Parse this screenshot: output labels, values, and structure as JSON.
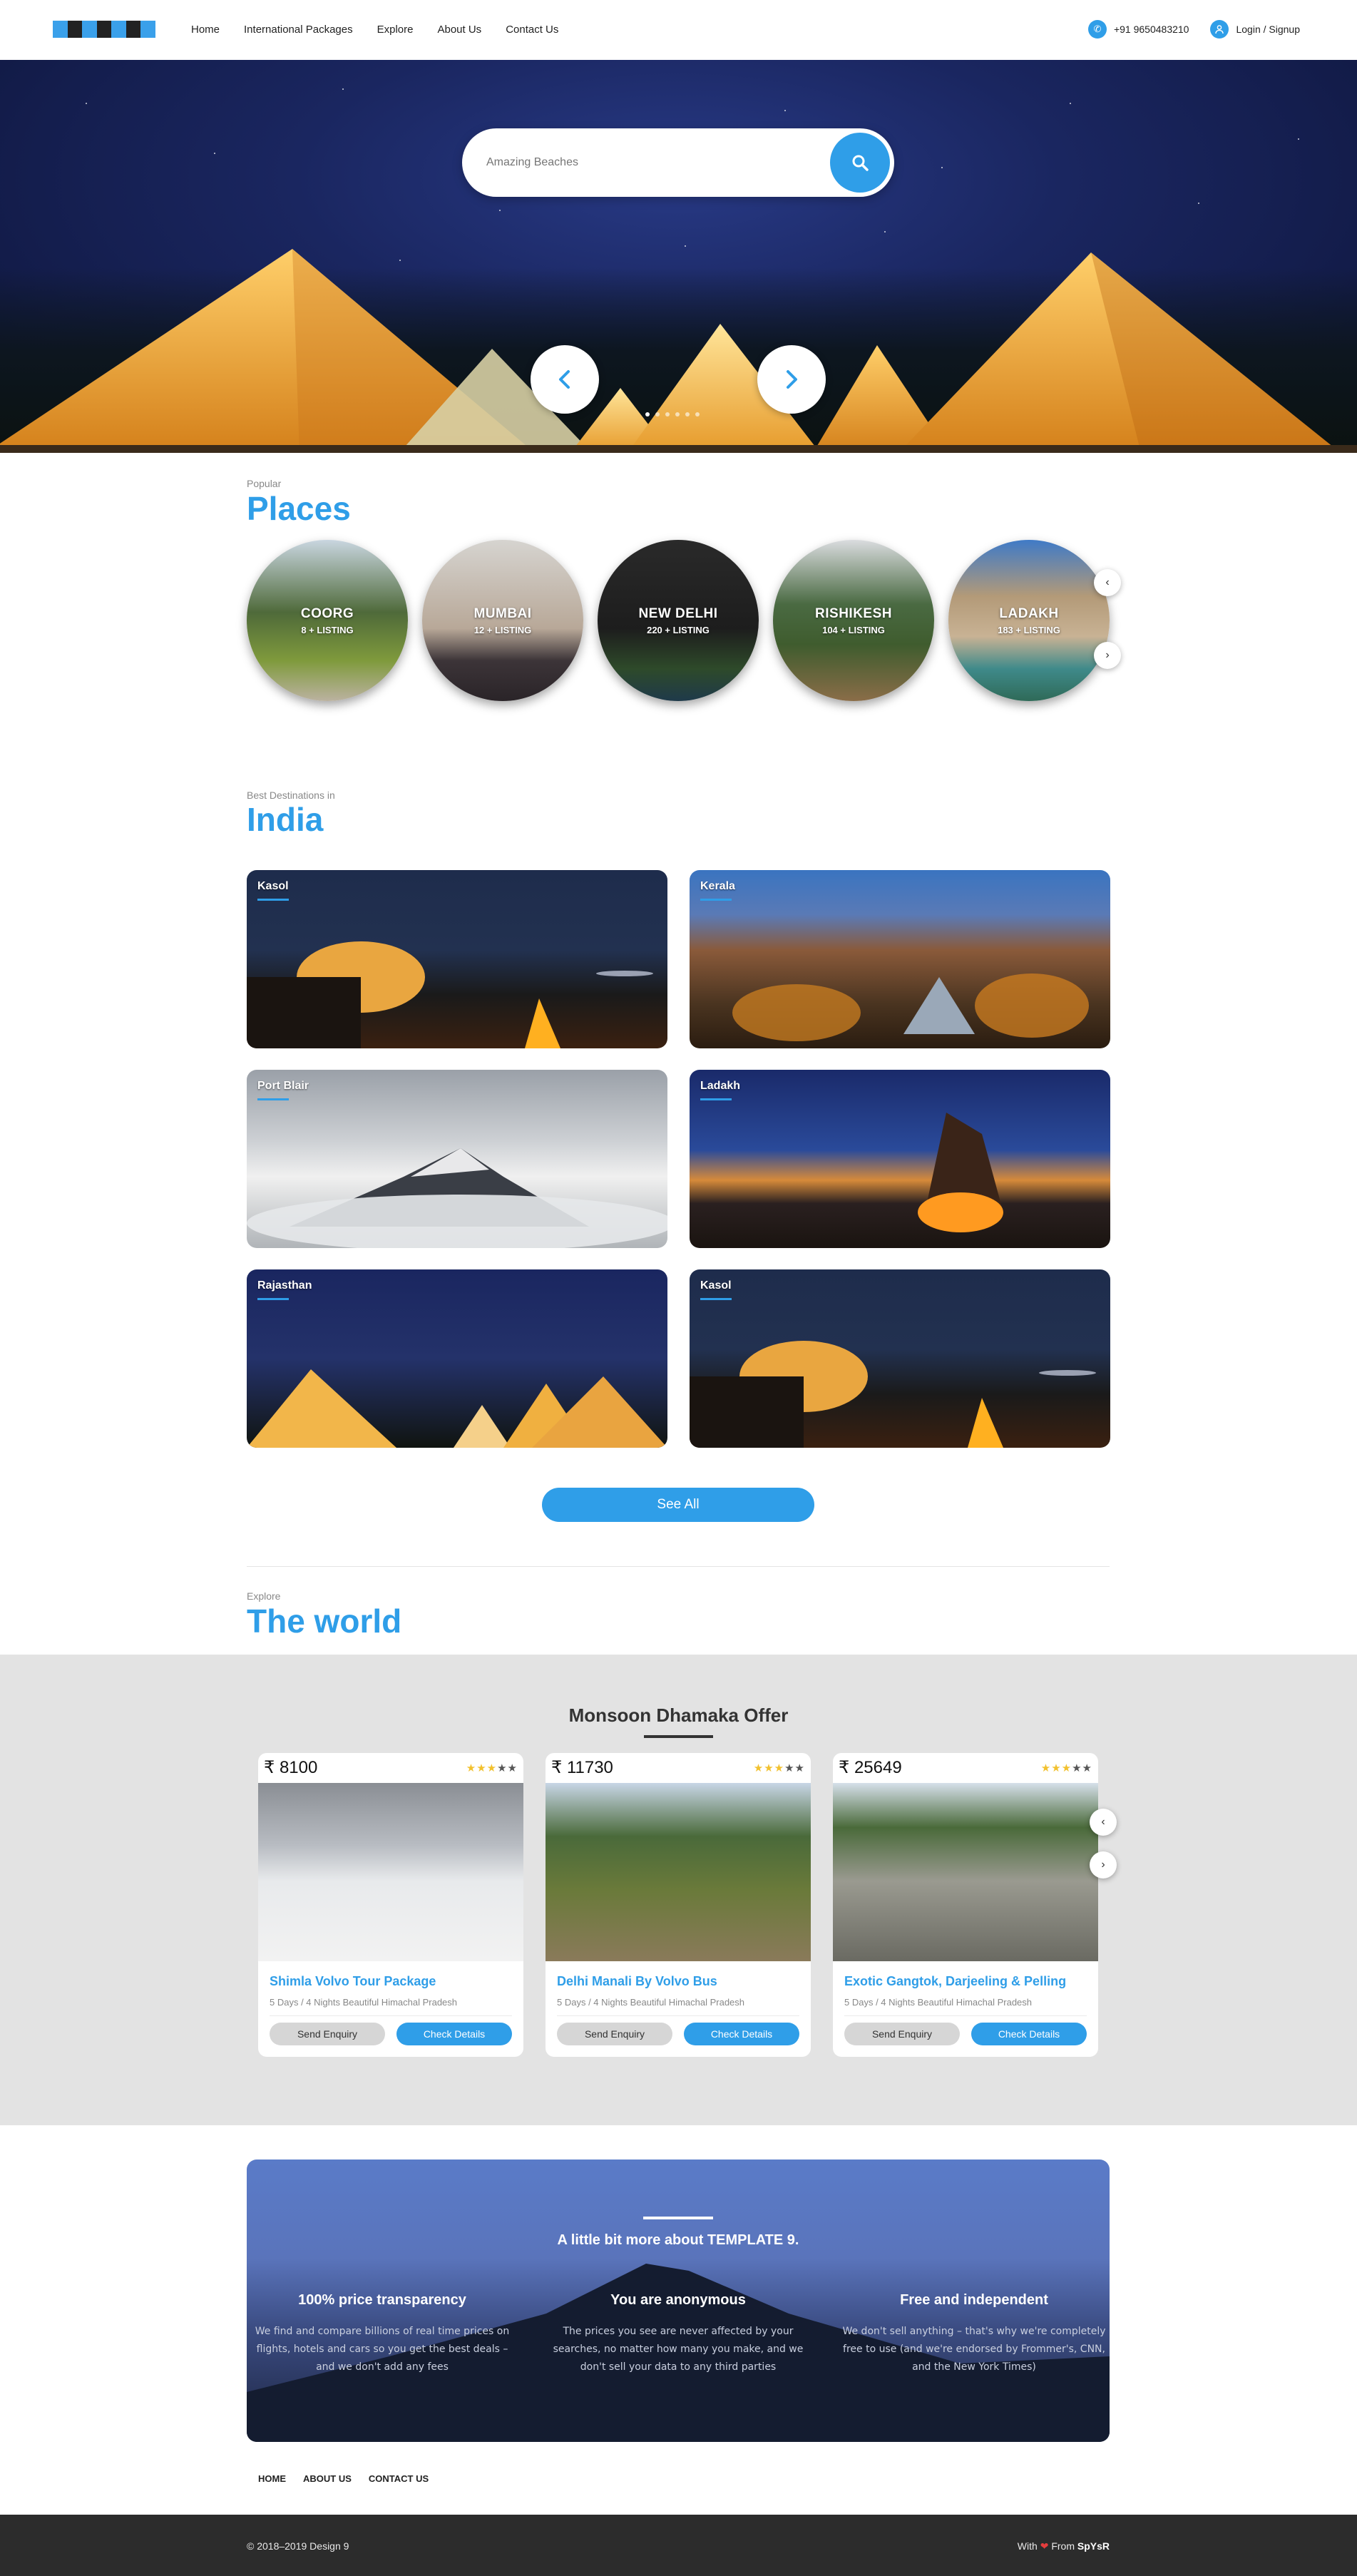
{
  "header": {
    "nav": [
      "Home",
      "International Packages",
      "Explore",
      "About Us",
      "Contact Us"
    ],
    "phone": "+91 9650483210",
    "login": "Login / Signup"
  },
  "hero": {
    "search_placeholder": "Amazing Beaches",
    "prev_icon": "chevron-left",
    "next_icon": "chevron-right"
  },
  "places": {
    "eyebrow": "Popular",
    "title": "Places",
    "items": [
      {
        "name": "COORG",
        "count": "8 + LISTING"
      },
      {
        "name": "MUMBAI",
        "count": "12 + LISTING"
      },
      {
        "name": "NEW DELHI",
        "count": "220 + LISTING"
      },
      {
        "name": "RISHIKESH",
        "count": "104 + LISTING"
      },
      {
        "name": "LADAKH",
        "count": "183 + LISTING"
      }
    ]
  },
  "india": {
    "eyebrow": "Best Destinations in",
    "title": "India",
    "cards": [
      "Kasol",
      "Kerala",
      "Port Blair",
      "Ladakh",
      "Rajasthan",
      "Kasol"
    ],
    "see_all": "See All"
  },
  "world": {
    "eyebrow": "Explore",
    "title": "The world"
  },
  "offers": {
    "title": "Monsoon Dhamaka Offer",
    "cards": [
      {
        "price": "₹ 8100",
        "rating": 3,
        "title": "Shimla Volvo Tour Package",
        "desc": "5 Days / 4 Nights Beautiful Himachal Pradesh",
        "enquiry": "Send Enquiry",
        "details": "Check Details"
      },
      {
        "price": "₹ 11730",
        "rating": 3,
        "title": "Delhi Manali By Volvo Bus",
        "desc": "5 Days / 4 Nights Beautiful Himachal Pradesh",
        "enquiry": "Send Enquiry",
        "details": "Check Details"
      },
      {
        "price": "₹ 25649",
        "rating": 3,
        "title": "Exotic Gangtok, Darjeeling & Pelling",
        "desc": "5 Days / 4 Nights Beautiful Himachal Pradesh",
        "enquiry": "Send Enquiry",
        "details": "Check Details"
      }
    ]
  },
  "about": {
    "title": "A little bit more about TEMPLATE 9.",
    "columns": [
      {
        "heading": "100% price transparency",
        "text": "We find and compare billions of real time prices on flights, hotels and cars so you get the best deals – and we don't add any fees"
      },
      {
        "heading": "You are anonymous",
        "text": "The prices you see are never affected by your searches, no matter how many you make, and we don't sell your data to any third parties"
      },
      {
        "heading": "Free and independent",
        "text": "We don't sell anything – that's why we're completely free to use (and we're endorsed by Frommer's, CNN, and the New York Times)"
      }
    ]
  },
  "footer": {
    "links": [
      "HOME",
      "ABOUT US",
      "CONTACT US"
    ],
    "copyright": "© 2018–2019 Design 9",
    "with": "With",
    "from": "From",
    "brand": "SpYsR"
  },
  "colors": {
    "accent": "#2f9ee8",
    "dark": "#2c2c2c",
    "band": "#e3e3e3",
    "star": "#f2c12e"
  }
}
